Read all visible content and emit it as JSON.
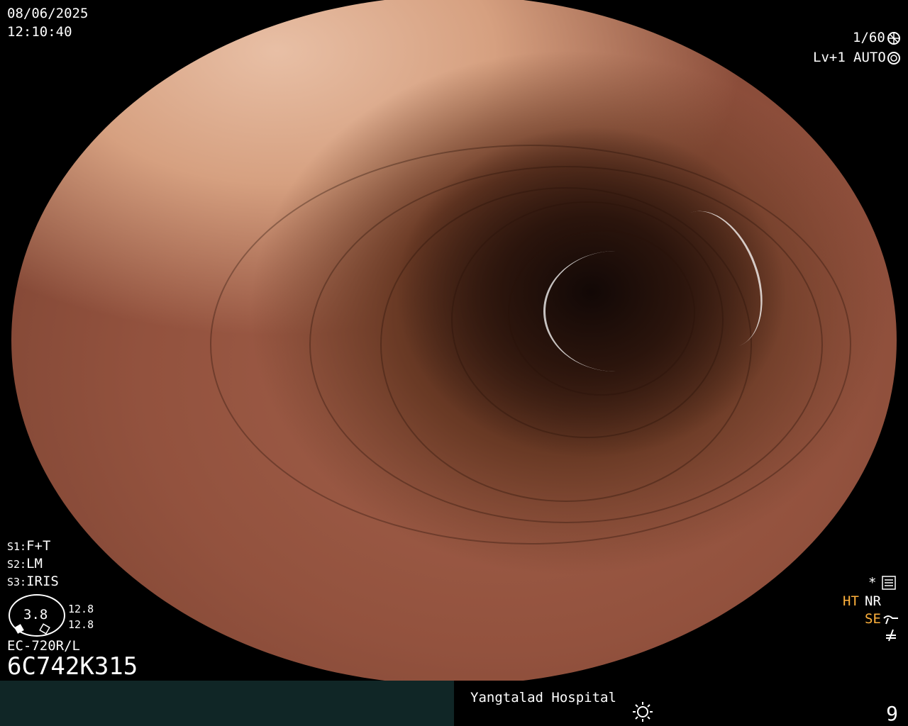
{
  "overlay": {
    "date": "08/06/2025",
    "time": "12:10:40",
    "shutter": "1/60",
    "level": "Lv+1",
    "mode": "AUTO",
    "s1_label": "S1:",
    "s1_value": "F+T",
    "s2_label": "S2:",
    "s2_value": "LM",
    "s3_label": "S3:",
    "s3_value": "IRIS",
    "gauge_value": "3.8",
    "gauge_top": "12.8",
    "gauge_bottom": "12.8",
    "scope_model": "EC-720R/L",
    "serial": "6C742K315",
    "ht": "HT",
    "nr": "NR",
    "se": "SE",
    "asterisk": "*"
  },
  "footer": {
    "hospital": "Yangtalad Hospital",
    "page": "9"
  },
  "icons": {
    "shutter": "aperture-icon",
    "auto": "iris-icon",
    "settings": "settings-icon",
    "se": "se-curve-icon",
    "slash": "slash-icon",
    "sun": "sun-icon"
  }
}
